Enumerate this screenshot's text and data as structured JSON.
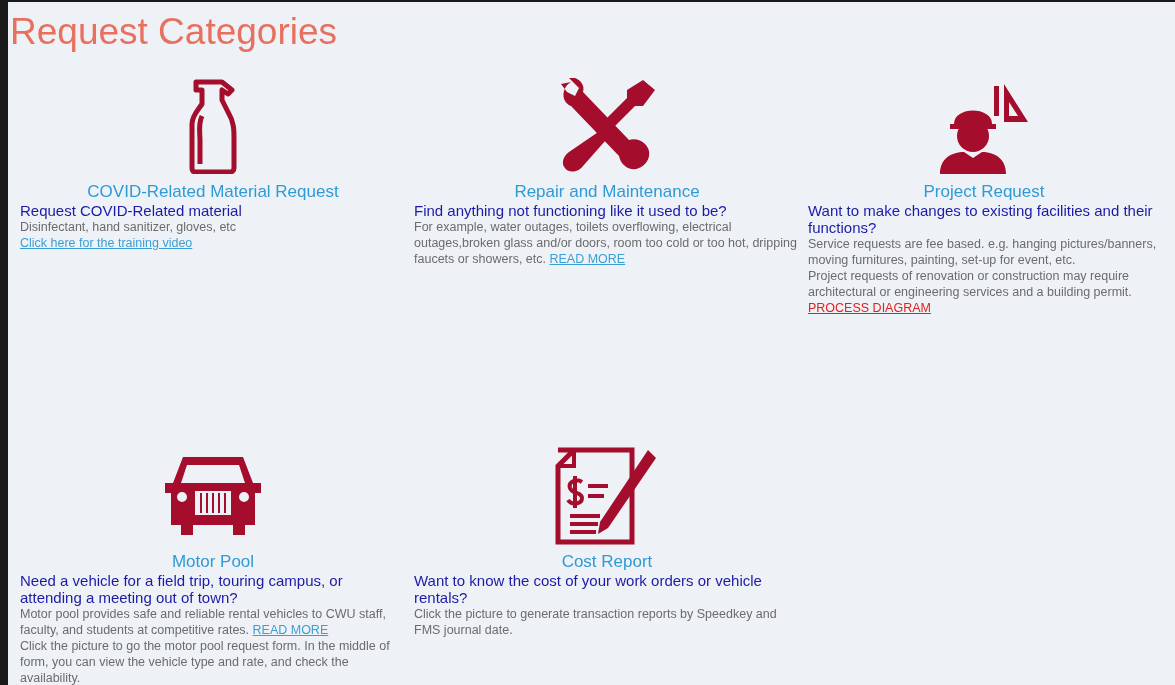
{
  "page": {
    "title": "Request Categories"
  },
  "categories": [
    {
      "title": "COVID-Related Material Request",
      "question": "Request COVID-Related material",
      "paragraphs": [
        [
          {
            "kind": "text",
            "text": "Disinfectant, hand sanitizer, gloves, etc "
          },
          {
            "kind": "link",
            "text": "Click here for the training video"
          }
        ]
      ]
    },
    {
      "title": "Repair and Maintenance",
      "question": "Find anything not functioning like it used to be?",
      "paragraphs": [
        [
          {
            "kind": "text",
            "text": "For example, water outages, toilets overflowing, electrical outages,broken glass and/or doors, room too cold or too hot, dripping faucets or showers, etc. "
          },
          {
            "kind": "link",
            "text": "READ MORE"
          }
        ]
      ]
    },
    {
      "title": "Project Request",
      "question": "Want to make changes to existing facilities and their functions?",
      "paragraphs": [
        [
          {
            "kind": "text",
            "text": "Service requests are fee based. e.g. hanging pictures/banners, moving furnitures, painting, set-up for event, etc."
          }
        ],
        [
          {
            "kind": "text",
            "text": "Project requests of renovation or construction may require architectural or engineering services and a building permit."
          }
        ],
        [
          {
            "kind": "red-link",
            "text": "PROCESS DIAGRAM"
          }
        ]
      ]
    },
    {
      "title": "Motor Pool",
      "question": "Need a vehicle for a field trip, touring campus, or attending a meeting out of town?",
      "paragraphs": [
        [
          {
            "kind": "text",
            "text": "Motor pool provides safe and reliable rental vehicles to CWU staff, faculty, and students at competitive rates. "
          },
          {
            "kind": "link",
            "text": "READ MORE"
          }
        ],
        [
          {
            "kind": "text",
            "text": "Click the picture to go the motor pool request form. In the middle of form, you can view the vehicle type and rate, and check the availability."
          }
        ]
      ]
    },
    {
      "title": "Cost Report",
      "question": "Want to know the cost of your work orders or vehicle rentals?",
      "paragraphs": [
        [
          {
            "kind": "text",
            "text": "Click the picture to generate transaction reports by Speedkey and FMS journal date."
          }
        ]
      ]
    }
  ]
}
